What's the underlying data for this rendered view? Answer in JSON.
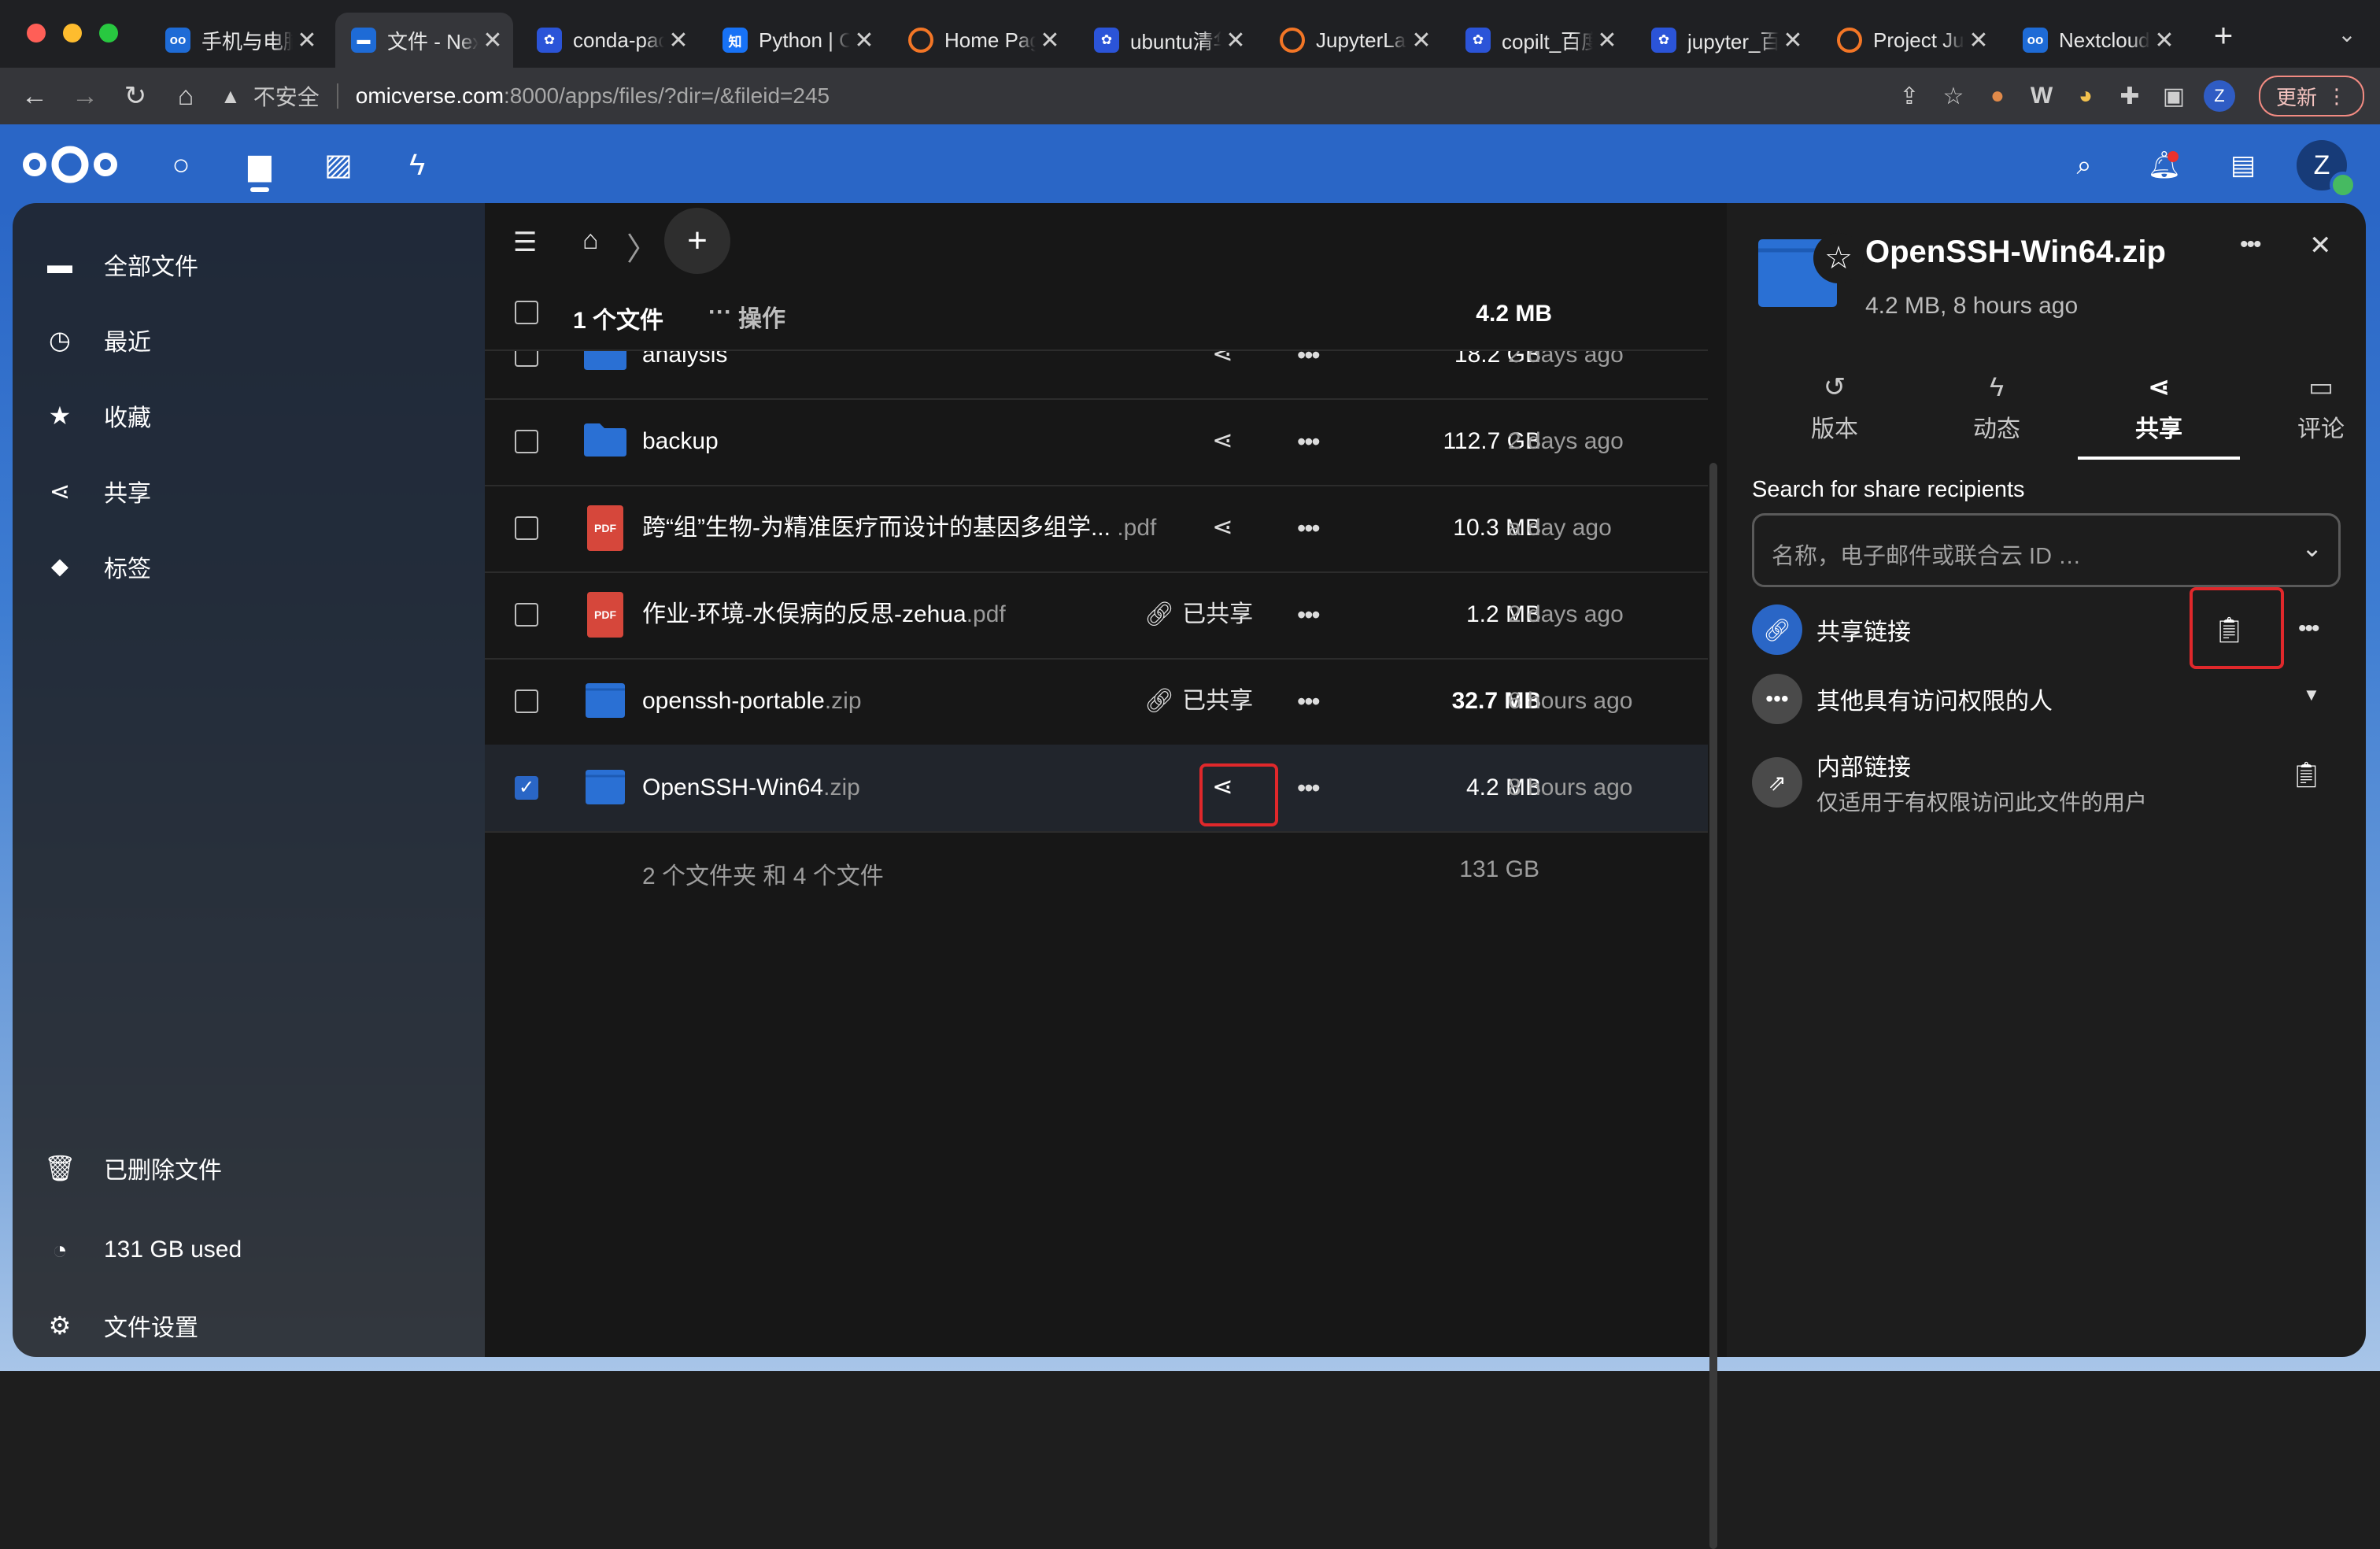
{
  "browser": {
    "tabs": [
      {
        "label": "手机与电脑",
        "favicon": "nextcloud-icon",
        "active": false
      },
      {
        "label": "文件 - Nextcloud",
        "favicon": "folder-icon",
        "active": true
      },
      {
        "label": "conda-pack",
        "favicon": "baidu-paw-icon",
        "active": false
      },
      {
        "label": "Python | Ch",
        "favicon": "zhihu-icon",
        "active": false
      },
      {
        "label": "Home Page",
        "favicon": "jupyter-icon",
        "active": false
      },
      {
        "label": "ubuntu清华",
        "favicon": "baidu-paw-icon",
        "active": false
      },
      {
        "label": "JupyterLab",
        "favicon": "jupyter-icon",
        "active": false
      },
      {
        "label": "copilt_百度",
        "favicon": "baidu-paw-icon",
        "active": false
      },
      {
        "label": "jupyter_百度",
        "favicon": "baidu-paw-icon",
        "active": false
      },
      {
        "label": "Project Ju",
        "favicon": "jupyter-icon",
        "active": false
      },
      {
        "label": "Nextcloud",
        "favicon": "nextcloud-icon",
        "active": false
      }
    ],
    "tab_close": "✕",
    "new_tab": "+",
    "security_label": "不安全",
    "url_host": "omicverse.com",
    "url_path": ":8000/apps/files/?dir=/&fileid=245",
    "update_label": "更新",
    "profile_initial": "Z"
  },
  "header": {
    "user_initial": "Z"
  },
  "sidebar": {
    "items": [
      {
        "label": "全部文件",
        "icon": "folder-icon"
      },
      {
        "label": "最近",
        "icon": "clock-icon"
      },
      {
        "label": "收藏",
        "icon": "star-icon"
      },
      {
        "label": "共享",
        "icon": "share-icon"
      },
      {
        "label": "标签",
        "icon": "tag-icon"
      }
    ],
    "bottom": [
      {
        "label": "已删除文件",
        "icon": "trash-icon"
      },
      {
        "label": "131 GB used",
        "icon": "pie-chart-icon"
      },
      {
        "label": "文件设置",
        "icon": "gear-icon"
      }
    ]
  },
  "files": {
    "selection_count": "1 个文件",
    "actions_label": "操作",
    "selection_size": "4.2 MB",
    "rows": [
      {
        "name": "analysis",
        "ext": "",
        "kind": "folder",
        "shared": "",
        "size": "18.2 GB",
        "modified": "2 days ago",
        "selected": false
      },
      {
        "name": "backup",
        "ext": "",
        "kind": "folder",
        "shared": "",
        "size": "112.7 GB",
        "modified": "2 days ago",
        "selected": false
      },
      {
        "name": "跨“组”生物-为精准医疗而设计的基因多组学...",
        "ext": " .pdf",
        "kind": "pdf",
        "shared": "",
        "size": "10.3 MB",
        "modified": "a day ago",
        "selected": false
      },
      {
        "name": "作业-环境-水俣病的反思-zehua",
        "ext": ".pdf",
        "kind": "pdf",
        "shared": "已共享",
        "size": "1.2 MB",
        "modified": "2 days ago",
        "selected": false
      },
      {
        "name": "openssh-portable",
        "ext": ".zip",
        "kind": "zip",
        "shared": "已共享",
        "size": "32.7 MB",
        "modified": "6 hours ago",
        "selected": false
      },
      {
        "name": "OpenSSH-Win64",
        "ext": ".zip",
        "kind": "zip",
        "shared": "",
        "size": "4.2 MB",
        "modified": "8 hours ago",
        "selected": true
      }
    ],
    "pdf_badge": "PDF",
    "summary": "2 个文件夹 和 4 个文件",
    "summary_size": "131 GB"
  },
  "panel": {
    "title": "OpenSSH-Win64.zip",
    "subtitle": "4.2 MB, 8 hours ago",
    "tabs": [
      {
        "label": "版本",
        "icon": "history-icon",
        "active": false
      },
      {
        "label": "动态",
        "icon": "activity-icon",
        "active": false
      },
      {
        "label": "共享",
        "icon": "share-icon",
        "active": true
      },
      {
        "label": "评论",
        "icon": "comment-icon",
        "active": false
      }
    ],
    "search_label": "Search for share recipients",
    "search_placeholder": "名称，电子邮件或联合云 ID …",
    "share_link_label": "共享链接",
    "others_label": "其他具有访问权限的人",
    "internal_link_label": "内部链接",
    "internal_link_desc": "仅适用于有权限访问此文件的用户"
  },
  "colors": {
    "accent": "#2a66c6",
    "highlight_box": "#e0282b",
    "pdf_red": "#d6473b",
    "folder_blue": "#2a70d4"
  }
}
